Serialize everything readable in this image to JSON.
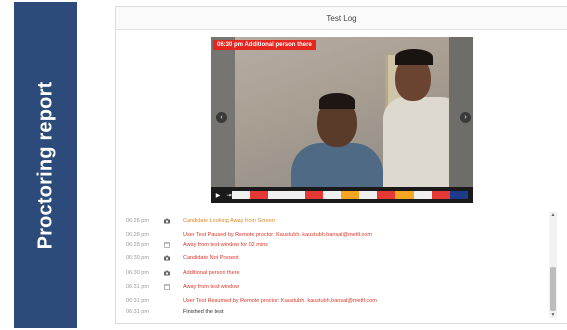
{
  "sidebar": {
    "title": "Proctoring report"
  },
  "panel": {
    "title": "Test Log"
  },
  "viewer": {
    "alert": "06:30 pm Additional person there",
    "prev_icon": "chevron-left-icon",
    "next_icon": "chevron-right-icon",
    "timeline_colors": [
      "#f0f0f0",
      "#e53935",
      "#f0f0f0",
      "#f0f0f0",
      "#e53935",
      "#f0f0f0",
      "#f5a623",
      "#f0f0f0",
      "#e53935",
      "#f5a623",
      "#f0f0f0",
      "#e53935",
      "#1e3a8a"
    ]
  },
  "log": [
    {
      "time": "06:26 pm",
      "icon": "camera-icon",
      "text": "Candidate Looking Away from Screen",
      "tone": "orange"
    },
    {
      "time": "06:28 pm",
      "icon": "",
      "text": "User Test Paused by Remote proctor: Kaustubh. kaustubh.bansal@mettl.com",
      "tone": "red"
    },
    {
      "time": "06:28 pm",
      "icon": "window-icon",
      "text": "Away from test window for 02 mins",
      "tone": "red"
    },
    {
      "time": "06:30 pm",
      "icon": "camera-icon",
      "text": "Candidate Not Present",
      "tone": "red"
    },
    {
      "time": "06:30 pm",
      "icon": "camera-icon",
      "text": "Additional person there",
      "tone": "red"
    },
    {
      "time": "06:31 pm",
      "icon": "window-icon",
      "text": "Away from test window",
      "tone": "red"
    },
    {
      "time": "06:31 pm",
      "icon": "",
      "text": "User Test Resumed by Remote proctor: Kaustubh. kaustubh.bansal@mettl.com",
      "tone": "red"
    },
    {
      "time": "06:31 pm",
      "icon": "",
      "text": "Finished the test",
      "tone": "black"
    }
  ]
}
